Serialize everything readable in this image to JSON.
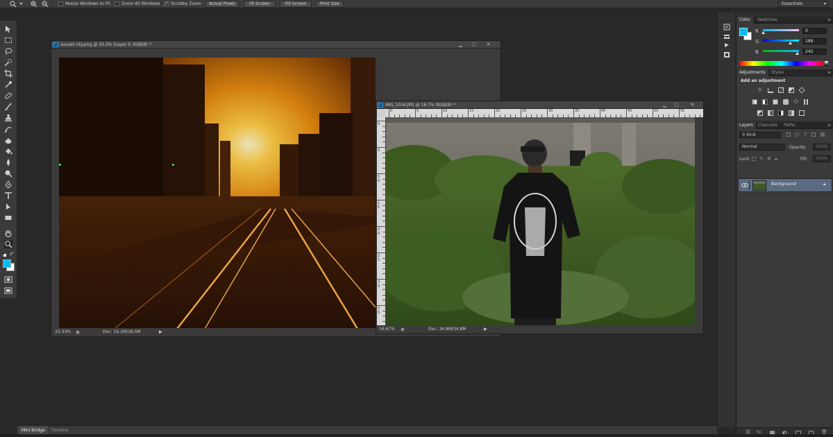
{
  "options_bar": {
    "zoom_tool_icon": "zoom-icon",
    "resize_windows_label": "Resize Windows to Fit",
    "zoom_all_label": "Zoom All Windows",
    "scrubby_zoom_label": "Scrubby Zoom",
    "scrubby_checked": true,
    "actual_pixels_label": "Actual Pixels",
    "fit_screen_label": "Fit Screen",
    "fill_screen_label": "Fill Screen",
    "print_size_label": "Print Size",
    "workspace_label": "Essentials"
  },
  "doc1": {
    "title": "sunset-city.png @ 33.3% (Layer 0, RGB/8) *",
    "zoom": "33.33%",
    "doc_size": "Doc: 16.1M/18.0M"
  },
  "doc2": {
    "title": "IMG_1016.JPG @ 16.7% (RGB/8) *",
    "zoom": "16.67%",
    "doc_size": "Doc: 34.8M/34.8M",
    "ruler_h": [
      "0",
      "5",
      "10",
      "15",
      "20",
      "25",
      "30",
      "35",
      "40",
      "45",
      "50",
      "55"
    ],
    "ruler_v": [
      "0",
      "5",
      "10",
      "15",
      "20",
      "25",
      "30",
      "35",
      "40"
    ]
  },
  "color_panel": {
    "tab_color": "Color",
    "tab_swatches": "Swatches",
    "r_label": "R",
    "g_label": "G",
    "b_label": "B",
    "r": 0,
    "g": 189,
    "b": 242,
    "foreground": "#00bdf2",
    "background": "#ffffff"
  },
  "adjustments_panel": {
    "tab_adjustments": "Adjustments",
    "tab_styles": "Styles",
    "heading": "Add an adjustment"
  },
  "layers_panel": {
    "tab_layers": "Layers",
    "tab_channels": "Channels",
    "tab_paths": "Paths",
    "filter_kind": "Kind",
    "blend_mode": "Normal",
    "opacity_label": "Opacity:",
    "opacity_value": "100%",
    "lock_label": "Lock:",
    "fill_label": "Fill:",
    "fill_value": "100%",
    "layers": [
      {
        "name": "Background",
        "visible": true,
        "locked": true
      }
    ]
  },
  "bottom_tabs": {
    "mini_bridge": "Mini Bridge",
    "timeline": "Timeline"
  },
  "colors": {
    "accent": "#31a8ff",
    "panel_bg": "#3a3a3a",
    "app_bg": "#282828"
  }
}
